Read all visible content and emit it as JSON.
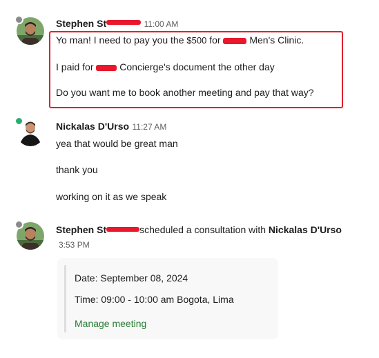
{
  "messages": [
    {
      "author_visible": "Stephen St",
      "time": "11:00 AM",
      "presence": "away",
      "lines": {
        "l1_a": "Yo man! I need to pay you the ",
        "l1_price": "$500",
        "l1_b": " for",
        "l1_c": "Men's Clinic.",
        "l2_a": "I paid for",
        "l2_b": "Concierge's document the other day",
        "l3": "Do you want me to book another meeting and pay that way?"
      }
    },
    {
      "author": "Nickalas D'Urso",
      "time": "11:27 AM",
      "presence": "active",
      "lines": [
        "yea that would be great man",
        "thank you",
        "working on it as we speak"
      ]
    },
    {
      "author_visible": "Stephen St",
      "action": "scheduled a consultation with",
      "target": "Nickalas D'Urso",
      "time": "3:53 PM",
      "presence": "away",
      "card": {
        "date": "Date: September 08, 2024",
        "time": "Time: 09:00 - 10:00 am Bogota, Lima",
        "link": "Manage meeting"
      }
    }
  ],
  "colors": {
    "highlight_border": "#e0202f",
    "redaction": "#e8192c",
    "link": "#2a7d34",
    "presence_active": "#2bac76",
    "presence_away": "#8a8a8a"
  }
}
